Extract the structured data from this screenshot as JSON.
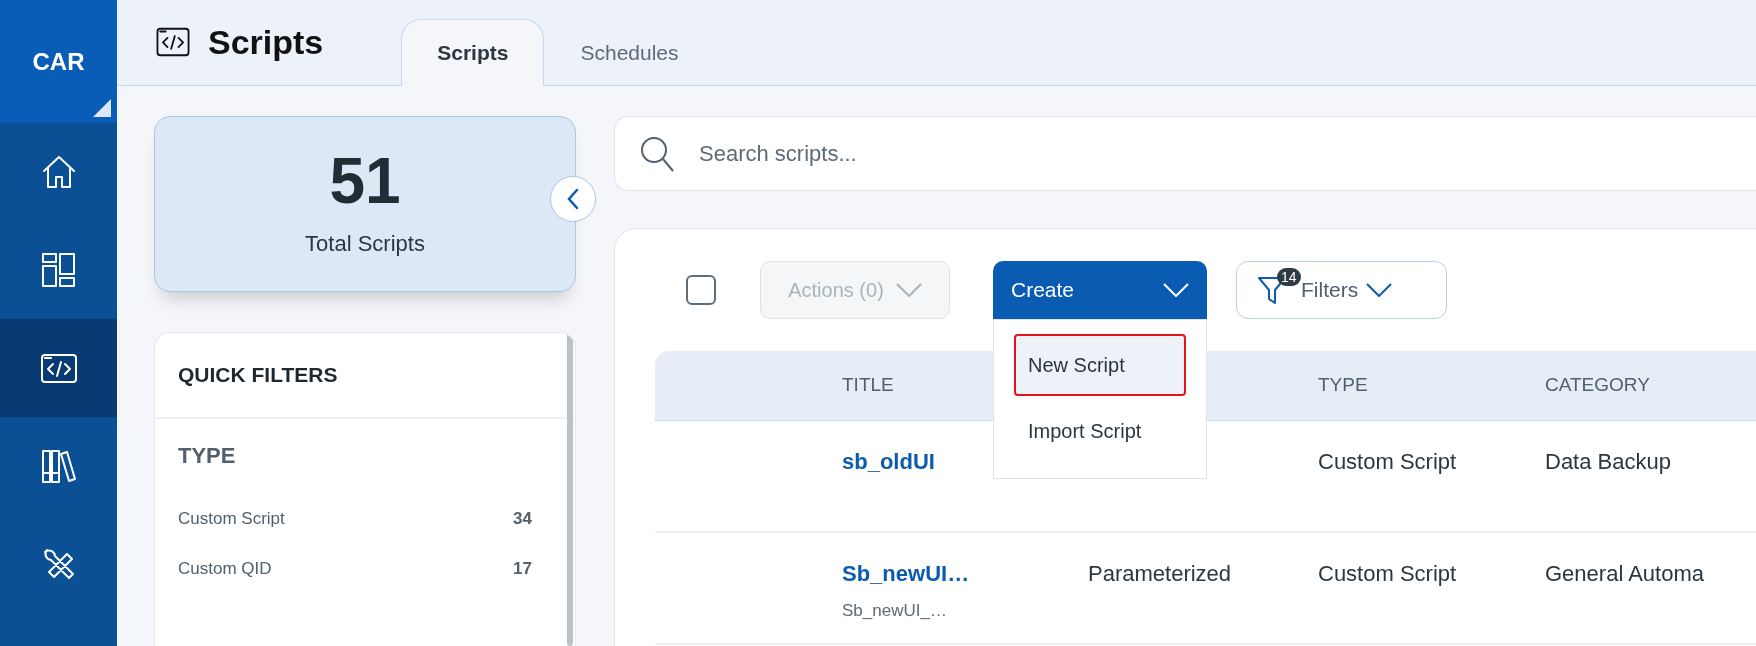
{
  "sidebar": {
    "logo": "CAR",
    "items": [
      {
        "kind": "home",
        "selected": false
      },
      {
        "kind": "dashboard",
        "selected": false
      },
      {
        "kind": "code",
        "selected": true
      },
      {
        "kind": "library",
        "selected": false
      },
      {
        "kind": "tools",
        "selected": false
      }
    ]
  },
  "header": {
    "title": "Scripts",
    "tabs": [
      {
        "label": "Scripts",
        "selected": true
      },
      {
        "label": "Schedules",
        "selected": false
      }
    ]
  },
  "summary": {
    "count": "51",
    "label": "Total Scripts"
  },
  "quick_filters": {
    "title": "QUICK FILTERS",
    "groups": [
      {
        "title": "TYPE",
        "items": [
          {
            "label": "Custom Script",
            "count": "34"
          },
          {
            "label": "Custom QID",
            "count": "17"
          }
        ]
      }
    ]
  },
  "search": {
    "placeholder": "Search scripts..."
  },
  "toolbar": {
    "select_all": {
      "checked": false
    },
    "actions": {
      "label": "Actions (0)",
      "disabled": true
    },
    "create": {
      "label": "Create",
      "expanded": true,
      "menu": [
        {
          "label": "New Script",
          "selected": true
        },
        {
          "label": "Import Script",
          "selected": false
        }
      ]
    },
    "filters": {
      "label": "Filters",
      "badge": "14"
    }
  },
  "table": {
    "columns": {
      "title": "TITLE",
      "type": "TYPE",
      "category": "CATEGORY"
    },
    "rows": [
      {
        "title": "sb_oldUI",
        "type": "Custom Script",
        "category": "Data Backup"
      },
      {
        "title": "Sb_newUI…",
        "subtitle": "Sb_newUI_…",
        "column_2": "Parameterized",
        "type": "Custom Script",
        "category": "General Automa"
      }
    ]
  }
}
